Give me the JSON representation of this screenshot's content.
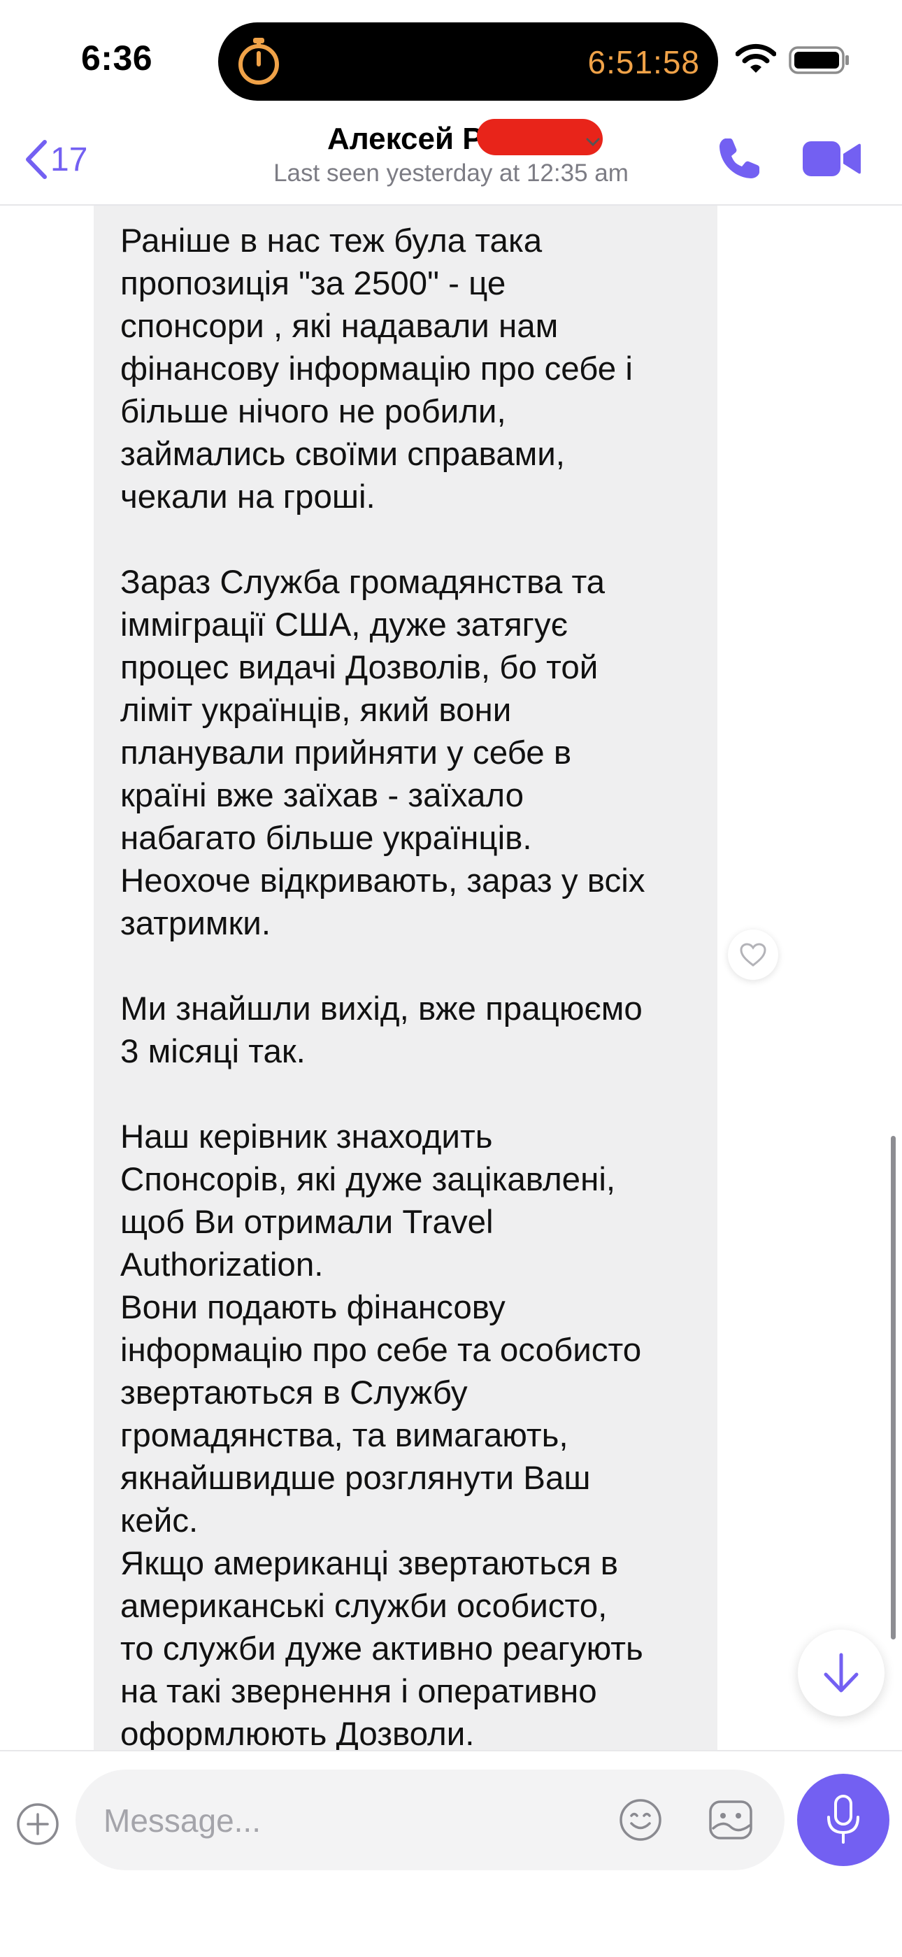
{
  "status_bar": {
    "time": "6:36",
    "island_timer": "6:51:58",
    "icons": [
      "stopwatch-icon",
      "wifi-icon",
      "battery-icon"
    ]
  },
  "header": {
    "back_count": "17",
    "contact_name": "Алексей Р",
    "last_seen": "Last seen yesterday at 12:35 am",
    "icons": [
      "chevron-left-icon",
      "phone-icon",
      "video-camera-icon"
    ]
  },
  "message": {
    "text": "Раніше в нас теж була така\nпропозиція \"за 2500\" - це\nспонсори , які надавали нам\nфінансову інформацію про себе і\nбільше нічого не робили,\nзаймались своїми справами,\nчекали на гроші.\n\nЗараз Служба громадянства та\nімміграції США, дуже затягує\nпроцес видачі Дозволів, бо той\nліміт українців, який вони\nпланували прийняти у себе в\nкраїні вже заїхав - заїхало\nнабагато більше українців.\nНеохоче відкривають, зараз у всіх\nзатримки.\n\nМи знайшли вихід, вже працюємо\n3 місяці так.\n\nНаш керівник знаходить\nСпонсорів, які дуже зацікавлені,\nщоб Ви отримали Travel\nAuthorization.\nВони подають фінансову\nінформацію про себе та особисто\nзвертаються в Службу\nгромадянства, та вимагають,\nякнайшвидше розглянути Ваш\nкейс.\nЯкщо американці звертаються в\nамериканські служби особисто,\nто служби дуже активно реагують\nна такі звернення і оперативно\nоформлюють Дозволи."
  },
  "composer": {
    "placeholder": "Message...",
    "icons": [
      "plus-circle-icon",
      "emoji-icon",
      "sticker-icon",
      "microphone-icon"
    ]
  },
  "colors": {
    "accent": "#7360f2",
    "timer": "#f0a248",
    "bubble": "#efeff0",
    "redaction": "#e8241a"
  }
}
